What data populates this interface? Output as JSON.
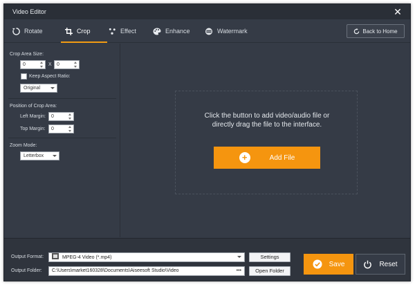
{
  "window": {
    "title": "Video Editor"
  },
  "tabs": [
    {
      "id": "rotate",
      "label": "Rotate",
      "icon": "rotate-icon"
    },
    {
      "id": "crop",
      "label": "Crop",
      "icon": "crop-icon"
    },
    {
      "id": "effect",
      "label": "Effect",
      "icon": "effect-icon"
    },
    {
      "id": "enhance",
      "label": "Enhance",
      "icon": "palette-icon"
    },
    {
      "id": "watermark",
      "label": "Watermark",
      "icon": "film-icon"
    }
  ],
  "active_tab": "Crop",
  "header": {
    "back_home_label": "Back to Home"
  },
  "crop": {
    "area_size_label": "Crop Area Size:",
    "width": "0",
    "height": "0",
    "times": "X",
    "keep_aspect_label": "Keep Aspect Ratio:",
    "aspect_value": "Original",
    "position_label": "Position of Crop Area:",
    "left_margin_label": "Left Margin:",
    "left_margin": "0",
    "top_margin_label": "Top Margin:",
    "top_margin": "0",
    "zoom_label": "Zoom Mode:",
    "zoom_value": "Letterbox"
  },
  "main": {
    "drop_text_line1": "Click the button to add video/audio file or",
    "drop_text_line2": "directly drag the file to the interface.",
    "add_file_label": "Add File"
  },
  "output": {
    "format_label": "Output Format:",
    "format_value": "MPEG-4 Video (*.mp4)",
    "settings_label": "Settings",
    "folder_label": "Output Folder:",
    "folder_value": "C:\\Users\\market160328\\Documents\\Aiseesoft Studio\\Video",
    "browse_label": "•••",
    "open_folder_label": "Open Folder",
    "save_label": "Save",
    "reset_label": "Reset"
  },
  "colors": {
    "accent": "#f5950f",
    "panel": "#353b46",
    "titlebar": "#2a2f37"
  }
}
